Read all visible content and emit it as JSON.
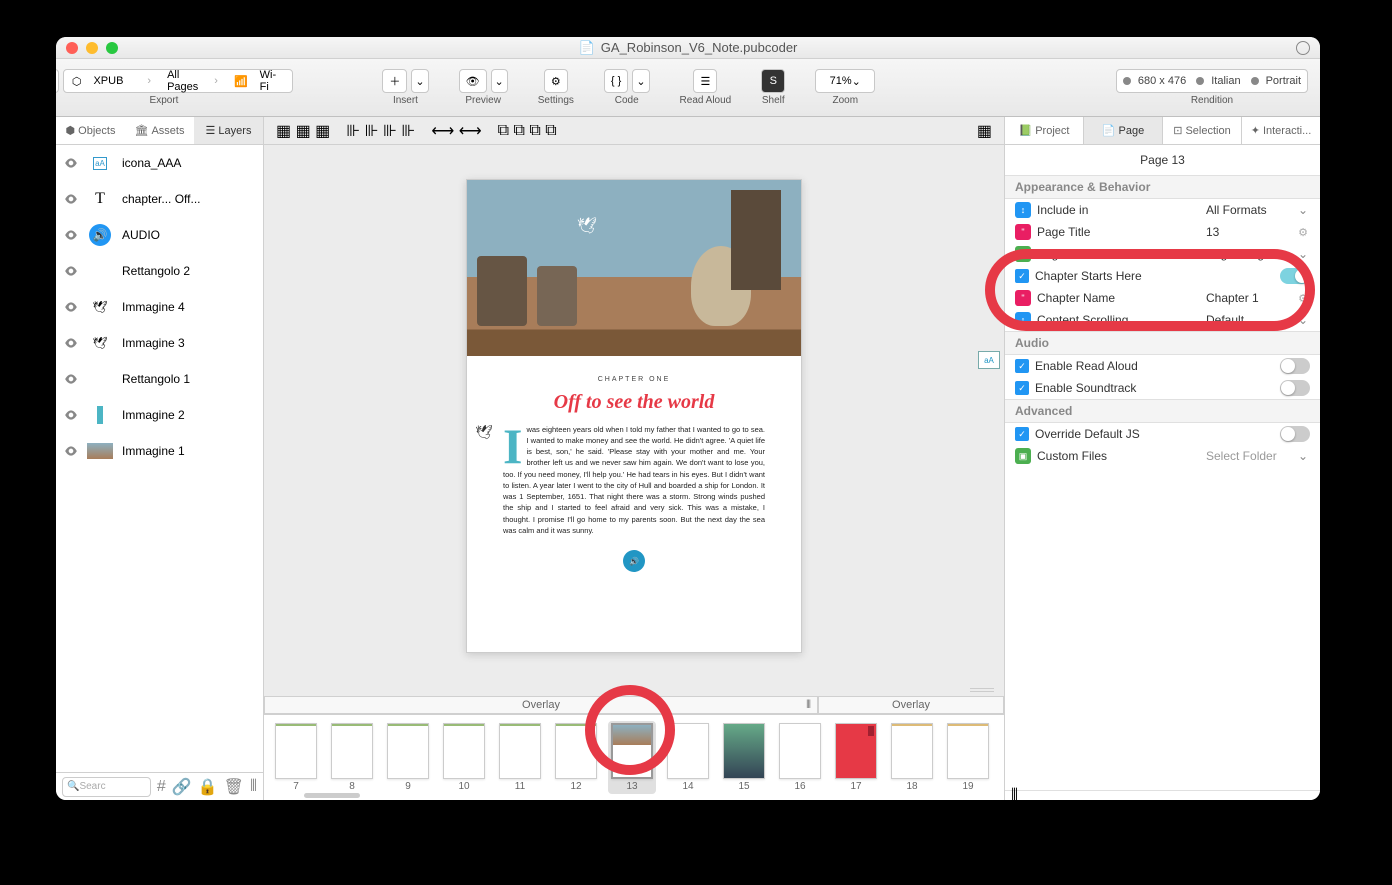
{
  "window": {
    "title": "GA_Robinson_V6_Note.pubcoder"
  },
  "toolbar": {
    "export_label": "Export",
    "breadcrumb": [
      "XPUB",
      "All Pages",
      "Wi-Fi"
    ],
    "insert_label": "Insert",
    "preview_label": "Preview",
    "settings_label": "Settings",
    "code_label": "Code",
    "read_aloud_label": "Read Aloud",
    "shelf_label": "Shelf",
    "zoom_label": "Zoom",
    "zoom_value": "71%",
    "rendition_label": "Rendition",
    "rendition_pills": [
      "680 x 476",
      "Italian",
      "Portrait"
    ]
  },
  "left_panel": {
    "tabs": [
      "Objects",
      "Assets",
      "Layers"
    ],
    "active_tab": 2,
    "layers": [
      {
        "name": "icona_AAA",
        "icon": "aa"
      },
      {
        "name": "chapter... Off...",
        "icon": "text"
      },
      {
        "name": "AUDIO",
        "icon": "audio"
      },
      {
        "name": "Rettangolo 2",
        "icon": "rect"
      },
      {
        "name": "Immagine 4",
        "icon": "img"
      },
      {
        "name": "Immagine 3",
        "icon": "img"
      },
      {
        "name": "Rettangolo 1",
        "icon": "rect"
      },
      {
        "name": "Immagine 2",
        "icon": "img"
      },
      {
        "name": "Immagine 1",
        "icon": "img"
      }
    ],
    "search_placeholder": "Searc"
  },
  "center": {
    "page": {
      "chapter_label": "CHAPTER ONE",
      "chapter_title": "Off to see the world",
      "body_text": "was eighteen years old when I told my father that I wanted to go to sea. I wanted to make money and see the world. He didn't agree.\n'A quiet life is best, son,' he said. 'Please stay with your mother and me. Your brother left us and we never saw him again. We don't want to lose you, too. If you need money, I'll help you.' He had tears in his eyes.\nBut I didn't want to listen. A year later I went to the city of Hull and boarded a ship for London. It was 1 September, 1651. That night there was a storm. Strong winds pushed the ship and I started to feel afraid and very sick. This was a mistake, I thought. I promise I'll go home to my parents soon. But the next day the sea was calm and it was sunny.",
      "dropcap": "I"
    },
    "overlay_label": "Overlay",
    "thumbnails": [
      {
        "n": "7"
      },
      {
        "n": "8"
      },
      {
        "n": "9"
      },
      {
        "n": "10"
      },
      {
        "n": "11"
      },
      {
        "n": "12"
      },
      {
        "n": "13",
        "active": true
      },
      {
        "n": "14"
      },
      {
        "n": "15"
      },
      {
        "n": "16"
      },
      {
        "n": "17"
      },
      {
        "n": "18"
      },
      {
        "n": "19"
      }
    ]
  },
  "right_panel": {
    "tabs": [
      "Project",
      "Page",
      "Selection",
      "Interacti..."
    ],
    "active_tab": 1,
    "page_header": "Page 13",
    "sections": {
      "appearance": {
        "title": "Appearance & Behavior",
        "rows": [
          {
            "label": "Include in",
            "value": "All Formats",
            "icon_color": "#2196f3",
            "ctrl": "chev"
          },
          {
            "label": "Page Title",
            "value": "13",
            "icon_color": "#e91e63",
            "ctrl": "gear"
          },
          {
            "label": "Page Thumbnail",
            "value": "Page Image",
            "icon_color": "#4caf50",
            "ctrl": "chev"
          },
          {
            "label": "Chapter Starts Here",
            "checkbox": true,
            "toggle": "on"
          },
          {
            "label": "Chapter Name",
            "value": "Chapter 1",
            "icon_color": "#e91e63",
            "ctrl": "gear"
          },
          {
            "label": "Content Scrolling",
            "value": "Default",
            "icon_color": "#2196f3",
            "ctrl": "chev"
          }
        ]
      },
      "audio": {
        "title": "Audio",
        "rows": [
          {
            "label": "Enable Read Aloud",
            "checkbox": true,
            "toggle": "off"
          },
          {
            "label": "Enable Soundtrack",
            "checkbox": true,
            "toggle": "off"
          }
        ]
      },
      "advanced": {
        "title": "Advanced",
        "rows": [
          {
            "label": "Override Default JS",
            "checkbox": true,
            "toggle": "off"
          },
          {
            "label": "Custom Files",
            "value": "Select Folder",
            "icon_color": "#4caf50",
            "ctrl": "chev"
          }
        ]
      }
    }
  }
}
